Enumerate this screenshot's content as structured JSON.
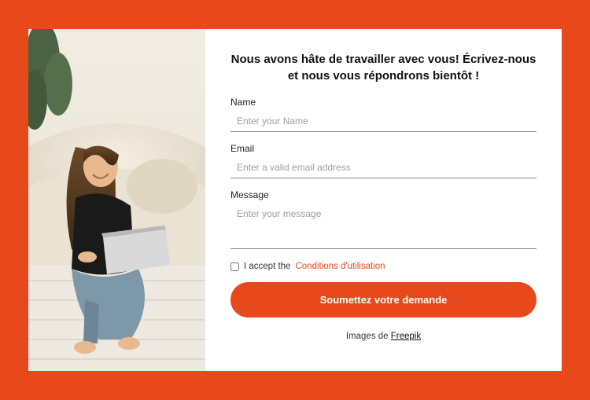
{
  "form": {
    "title": "Nous avons hâte de travailler avec vous! Écrivez-nous et nous vous répondrons bientôt !",
    "fields": {
      "name": {
        "label": "Name",
        "placeholder": "Enter your Name"
      },
      "email": {
        "label": "Email",
        "placeholder": "Enter a valid email address"
      },
      "message": {
        "label": "Message",
        "placeholder": "Enter your message"
      }
    },
    "consent": {
      "prefix": "I accept the ",
      "link": "Conditions d'utilisation"
    },
    "submit": "Soumettez votre demande",
    "credit_prefix": "Images de ",
    "credit_link": "Freepik"
  },
  "colors": {
    "accent": "#e8491c"
  }
}
